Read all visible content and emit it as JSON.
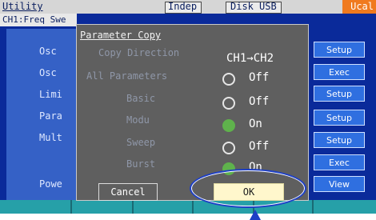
{
  "statusbar": {
    "utility": "Utility",
    "mode": "Indep",
    "disk": "Disk",
    "usb": "USB",
    "ucal": "Ucal"
  },
  "channel_tab": "CH1:Freq Swe",
  "background_rows": [
    "Osc",
    "Osc",
    "Limi",
    "Para",
    "Mult",
    "Powe"
  ],
  "softkeys": [
    "Setup",
    "Exec",
    "Setup",
    "Setup",
    "Setup",
    "Exec",
    "View"
  ],
  "dialog": {
    "title": "Parameter Copy",
    "copy_direction_label": "Copy Direction",
    "copy_direction_value": "CH1→CH2",
    "all_parameters_label": "All Parameters",
    "all_parameters_value": "Off",
    "basic_label": "Basic",
    "basic_value": "Off",
    "modu_label": "Modu",
    "modu_value": "On",
    "sweep_label": "Sweep",
    "sweep_value": "Off",
    "burst_label": "Burst",
    "burst_value": "On",
    "cancel_label": "Cancel",
    "ok_label": "OK"
  },
  "colors": {
    "screen_bg": "#0a2a9a",
    "dialog_bg": "#5f5f5f",
    "radio_on": "#5fb24c",
    "ok_bg": "#fff7cc",
    "highlight": "#1d3fc6",
    "ucal": "#f07a1e"
  },
  "icons": [
    "radio-off-icon",
    "radio-on-icon",
    "pointer-arrow-icon"
  ]
}
